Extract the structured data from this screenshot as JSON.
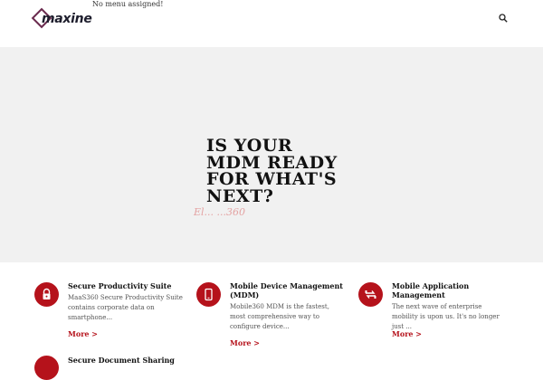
{
  "header": {
    "logo_text": "maxine",
    "menu_notice": "No menu assigned!"
  },
  "hero": {
    "title": "IS YOUR MDM READY FOR WHAT'S NEXT?",
    "subtitle": "El... ...360"
  },
  "features": [
    {
      "icon": "lock-icon",
      "title": "Secure Productivity Suite",
      "description": "MaaS360 Secure Productivity Suite contains corporate data on smartphone...",
      "more": "More >"
    },
    {
      "icon": "smartphone-icon",
      "title": "Mobile Device Management (MDM)",
      "description": "Mobile360 MDM is the fastest, most comprehensive way to configure device...",
      "more": "More >"
    },
    {
      "icon": "sync-icon",
      "title": "Mobile Application Management",
      "description": "The next wave of enterprise mobility is upon us. It's no longer just ...",
      "more": "More >"
    },
    {
      "icon": "share-icon",
      "title": "Secure Document Sharing"
    }
  ],
  "colors": {
    "accent": "#b5121b",
    "hero_bg": "#f1f1f1",
    "logo": "#6a2a4e"
  }
}
